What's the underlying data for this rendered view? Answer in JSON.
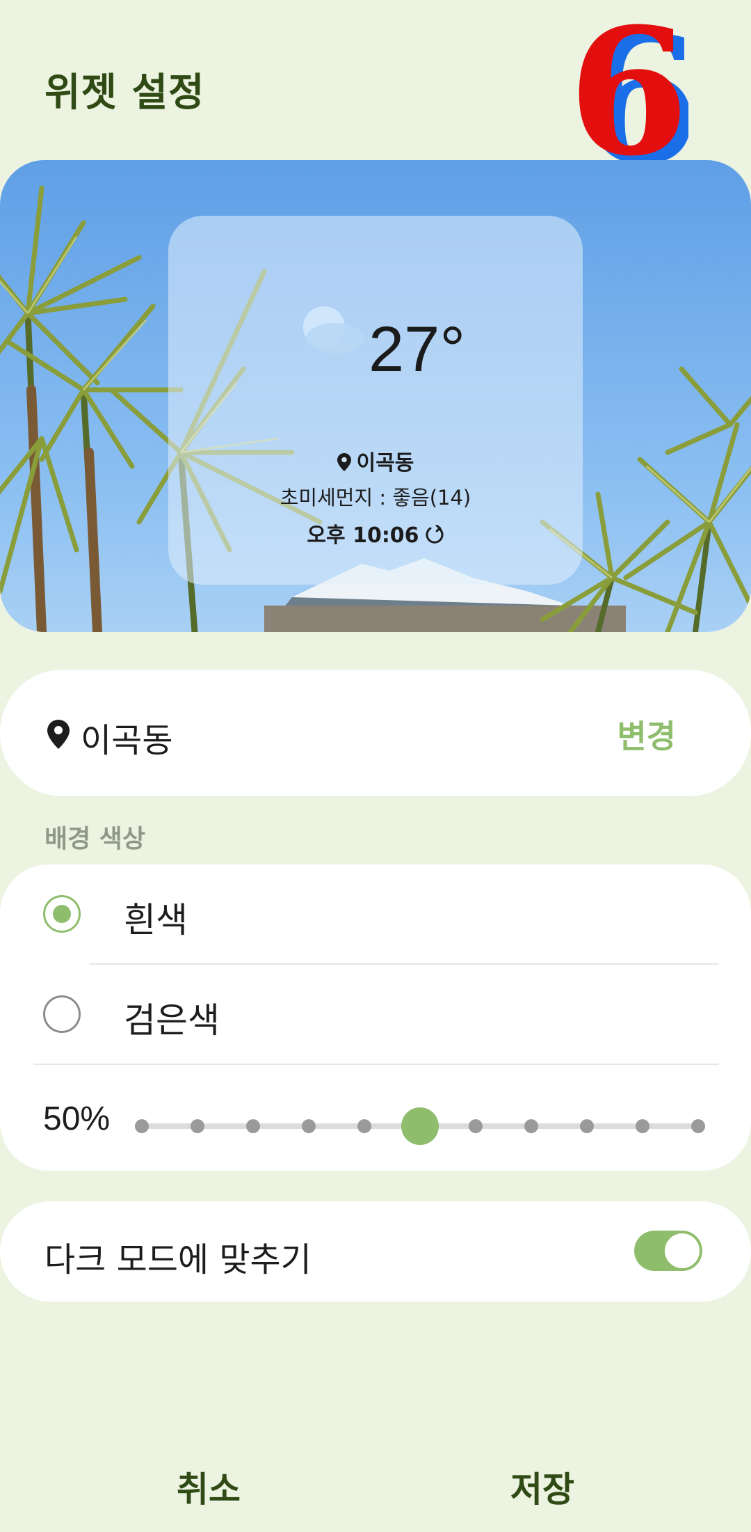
{
  "header": {
    "title": "위젯 설정",
    "badge_text": "6"
  },
  "preview": {
    "temperature": "27°",
    "location": "이곡동",
    "fine_dust": "초미세먼지 : 좋음(14)",
    "updated_time": "오후 10:06",
    "weather_icon": "partly-cloudy-icon"
  },
  "location_card": {
    "name": "이곡동",
    "change_label": "변경"
  },
  "background_color": {
    "section_label": "배경 색상",
    "options": [
      {
        "label": "흰색",
        "selected": true
      },
      {
        "label": "검은색",
        "selected": false
      }
    ],
    "transparency_label": "50%",
    "transparency_value": 50
  },
  "dark_mode": {
    "label": "다크 모드에 맞추기",
    "enabled": true
  },
  "footer": {
    "cancel_label": "취소",
    "save_label": "저장"
  },
  "colors": {
    "accent": "#8ebd6c",
    "title": "#2f4a14",
    "background": "#ecf3e0"
  }
}
